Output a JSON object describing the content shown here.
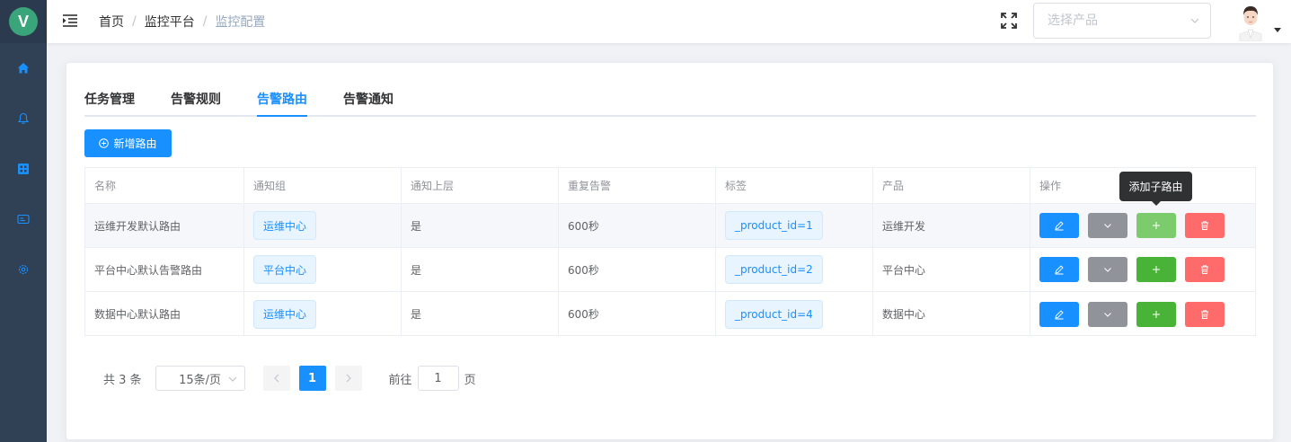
{
  "app": {
    "logo_letter": "V"
  },
  "sidebar": {
    "items": [
      {
        "icon": "home-icon",
        "active": true
      },
      {
        "icon": "bell-icon"
      },
      {
        "icon": "grid-icon"
      },
      {
        "icon": "card-icon"
      },
      {
        "icon": "gear-icon"
      }
    ]
  },
  "header": {
    "breadcrumb": [
      "首页",
      "监控平台",
      "监控配置"
    ],
    "product_select": {
      "placeholder": "选择产品",
      "value": ""
    }
  },
  "tabs": {
    "items": [
      "任务管理",
      "告警规则",
      "告警路由",
      "告警通知"
    ],
    "active": "告警路由"
  },
  "toolbar": {
    "add_label": "新增路由"
  },
  "table": {
    "columns": [
      "名称",
      "通知组",
      "通知上层",
      "重复告警",
      "标签",
      "产品",
      "操作"
    ],
    "rows": [
      {
        "name": "运维开发默认路由",
        "group": "运维中心",
        "notify_upper": "是",
        "repeat": "600秒",
        "label": "_product_id=1",
        "product": "运维开发"
      },
      {
        "name": "平台中心默认告警路由",
        "group": "平台中心",
        "notify_upper": "是",
        "repeat": "600秒",
        "label": "_product_id=2",
        "product": "平台中心"
      },
      {
        "name": "数据中心默认路由",
        "group": "运维中心",
        "notify_upper": "是",
        "repeat": "600秒",
        "label": "_product_id=4",
        "product": "数据中心"
      }
    ]
  },
  "tooltip": {
    "text": "添加子路由"
  },
  "pagination": {
    "total_text": "共 3 条",
    "page_size": "15条/页",
    "current_page": "1",
    "goto_prefix": "前往",
    "goto_value": "1",
    "goto_suffix": "页"
  },
  "colors": {
    "primary": "#1890ff",
    "sidebar_bg": "#304156",
    "edit": "#1890ff",
    "more": "#909399",
    "add": "#48b336",
    "delete": "#ff6b6b"
  }
}
